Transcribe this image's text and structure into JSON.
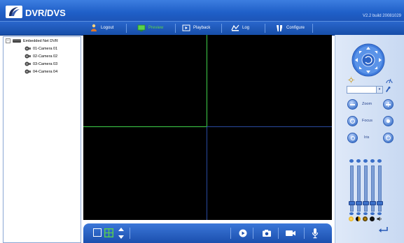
{
  "app": {
    "title": "DVR/DVS",
    "version": "V2.2  build 20081029"
  },
  "menu": {
    "items": [
      {
        "label": "Logout",
        "icon": "logout-icon"
      },
      {
        "label": "Preview",
        "icon": "preview-icon"
      },
      {
        "label": "Playback",
        "icon": "playback-icon"
      },
      {
        "label": "Log",
        "icon": "log-icon"
      },
      {
        "label": "Configure",
        "icon": "configure-icon"
      }
    ]
  },
  "tree": {
    "root": "Embedded Net DVR",
    "cameras": [
      "01-Camera 01",
      "02-Camera 02",
      "03-Camera 03",
      "04-Camera 04"
    ]
  },
  "ptz": {
    "zoom": "Zoom",
    "focus": "Focus",
    "iris": "Iris"
  },
  "colors": {
    "accent": "#1f5fc8",
    "active_pane": "#3fd24a",
    "preview_tab": "#5ad24a"
  }
}
